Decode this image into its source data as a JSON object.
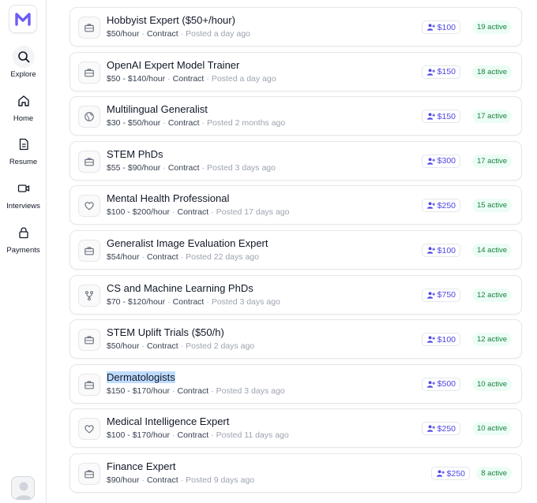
{
  "brand": {
    "logo_letter": "M",
    "accent": "#6d5ef5"
  },
  "sidebar": {
    "items": [
      {
        "label": "Explore",
        "icon": "search-icon",
        "active": true
      },
      {
        "label": "Home",
        "icon": "home-icon",
        "active": false
      },
      {
        "label": "Resume",
        "icon": "document-icon",
        "active": false
      },
      {
        "label": "Interviews",
        "icon": "video-icon",
        "active": false
      },
      {
        "label": "Payments",
        "icon": "lock-icon",
        "active": false
      }
    ]
  },
  "jobs": [
    {
      "title": "Hobbyist Expert ($50+/hour)",
      "rate": "$50/hour",
      "type": "Contract",
      "posted": "Posted a day ago",
      "bonus": "$100",
      "active": "19 active",
      "icon": "briefcase-icon"
    },
    {
      "title": "OpenAI Expert Model Trainer",
      "rate": "$50 - $140/hour",
      "type": "Contract",
      "posted": "Posted a day ago",
      "bonus": "$150",
      "active": "18 active",
      "icon": "briefcase-icon"
    },
    {
      "title": "Multilingual Generalist",
      "rate": "$30 - $50/hour",
      "type": "Contract",
      "posted": "Posted 2 months ago",
      "bonus": "$150",
      "active": "17 active",
      "icon": "globe-icon"
    },
    {
      "title": "STEM PhDs",
      "rate": "$55 - $90/hour",
      "type": "Contract",
      "posted": "Posted 3 days ago",
      "bonus": "$300",
      "active": "17 active",
      "icon": "briefcase-icon"
    },
    {
      "title": "Mental Health Professional",
      "rate": "$100 - $200/hour",
      "type": "Contract",
      "posted": "Posted 17 days ago",
      "bonus": "$250",
      "active": "15 active",
      "icon": "heart-icon"
    },
    {
      "title": "Generalist Image Evaluation Expert",
      "rate": "$54/hour",
      "type": "Contract",
      "posted": "Posted 22 days ago",
      "bonus": "$100",
      "active": "14 active",
      "icon": "briefcase-icon"
    },
    {
      "title": "CS and Machine Learning PhDs",
      "rate": "$70 - $120/hour",
      "type": "Contract",
      "posted": "Posted 3 days ago",
      "bonus": "$750",
      "active": "12 active",
      "icon": "branch-icon"
    },
    {
      "title": "STEM Uplift Trials ($50/h)",
      "rate": "$50/hour",
      "type": "Contract",
      "posted": "Posted 2 days ago",
      "bonus": "$100",
      "active": "12 active",
      "icon": "briefcase-icon"
    },
    {
      "title": "Dermatologists",
      "rate": "$150 - $170/hour",
      "type": "Contract",
      "posted": "Posted 3 days ago",
      "bonus": "$500",
      "active": "10 active",
      "icon": "briefcase-icon",
      "selected_text": true
    },
    {
      "title": "Medical Intelligence Expert",
      "rate": "$100 - $170/hour",
      "type": "Contract",
      "posted": "Posted 11 days ago",
      "bonus": "$250",
      "active": "10 active",
      "icon": "heart-icon"
    },
    {
      "title": "Finance Expert",
      "rate": "$90/hour",
      "type": "Contract",
      "posted": "Posted 9 days ago",
      "bonus": "$250",
      "active": "8 active",
      "icon": "briefcase-icon"
    }
  ],
  "meta_separator": "·",
  "bonus_icon": "referral-user-icon",
  "colors": {
    "bonus_text": "#4f46e5",
    "active_bg": "#ecfdf5",
    "active_text": "#15803d",
    "selection": "#bfdbfe"
  }
}
